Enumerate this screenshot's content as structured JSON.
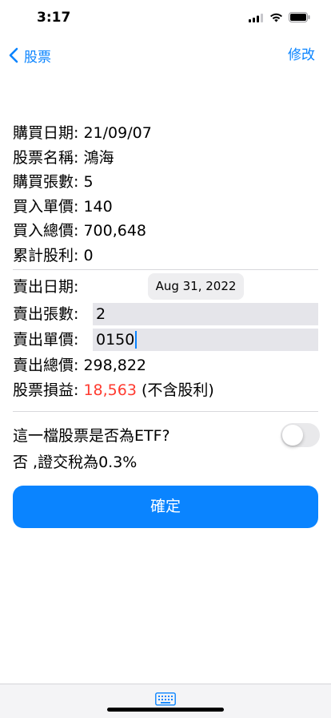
{
  "status_bar": {
    "time": "3:17"
  },
  "nav": {
    "back_label": "股票",
    "edit_label": "修改"
  },
  "purchase": {
    "date_label": "購買日期:",
    "date_value": "21/09/07",
    "name_label": "股票名稱:",
    "name_value": "鴻海",
    "shares_label": "購買張數:",
    "shares_value": "5",
    "price_label": "買入單價:",
    "price_value": "140",
    "total_label": "買入總價:",
    "total_value": "700,648",
    "dividend_label": "累計股利:",
    "dividend_value": "0"
  },
  "sale": {
    "date_label": "賣出日期:",
    "date_value": "Aug 31, 2022",
    "shares_label": "賣出張數:",
    "shares_value": "2",
    "price_label": "賣出單價:",
    "price_value": "0150",
    "total_label": "賣出總價:",
    "total_value": "298,822",
    "profit_label": "股票損益:",
    "profit_value": "18,563",
    "profit_note": "(不含股利)"
  },
  "etf": {
    "question": "這一檔股票是否為ETF?",
    "toggle_on": false,
    "tax_note": "否 ,證交稅為0.3%"
  },
  "confirm_label": "確定",
  "colors": {
    "accent": "#0a84ff",
    "loss_profit": "#ff3b30"
  },
  "icons": [
    "signal-icon",
    "wifi-icon",
    "battery-icon",
    "chevron-left-icon",
    "keyboard-icon"
  ]
}
